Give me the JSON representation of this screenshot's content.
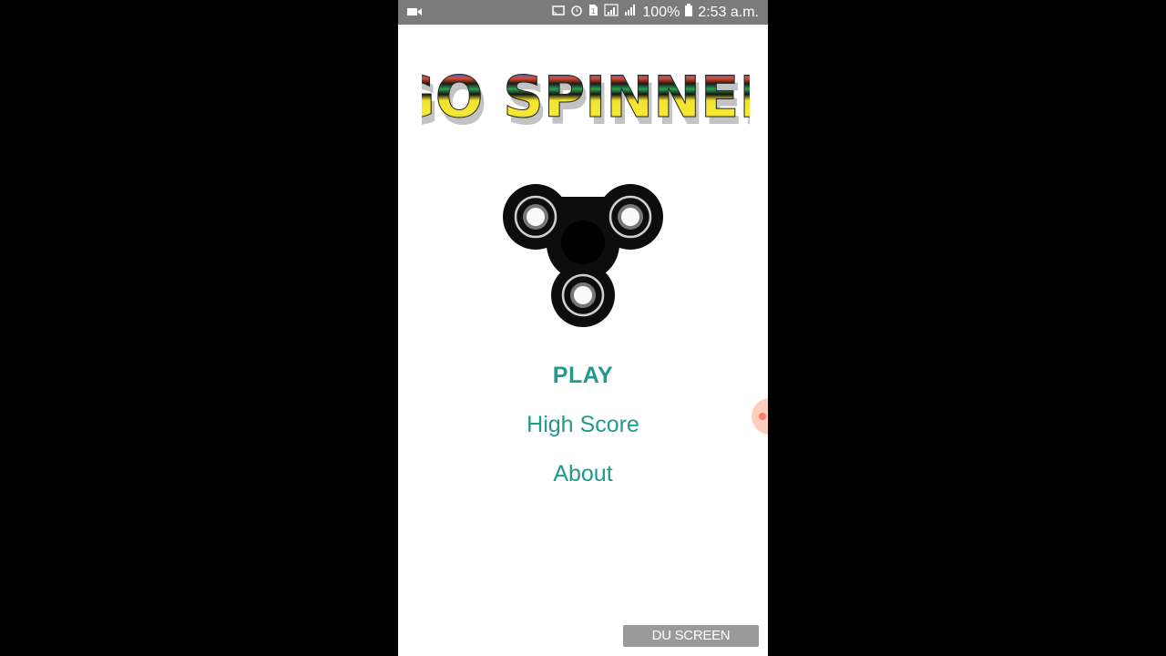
{
  "status_bar": {
    "battery": "100%",
    "time": "2:53 a.m.",
    "icons": [
      "video-icon",
      "cast-icon",
      "alarm-icon",
      "sim-icon",
      "signal-icon",
      "signal-icon",
      "battery-icon"
    ]
  },
  "logo": {
    "text": "GO SPINNER"
  },
  "menu": {
    "play": "PLAY",
    "high_score": "High Score",
    "about": "About"
  },
  "watermark": "DU SCREEN RECORDER",
  "colors": {
    "menu_text": "#1f9a8c",
    "status_bar": "#7b7b7b"
  }
}
